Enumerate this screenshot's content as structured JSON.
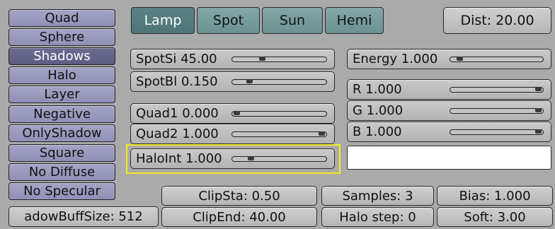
{
  "toggles": [
    {
      "id": "quad",
      "label": "Quad",
      "active": false
    },
    {
      "id": "sphere",
      "label": "Sphere",
      "active": false
    },
    {
      "id": "shadows",
      "label": "Shadows",
      "active": true
    },
    {
      "id": "halo",
      "label": "Halo",
      "active": false
    },
    {
      "id": "layer",
      "label": "Layer",
      "active": false
    },
    {
      "id": "negative",
      "label": "Negative",
      "active": false
    },
    {
      "id": "onlyshadow",
      "label": "OnlyShadow",
      "active": false
    },
    {
      "id": "square",
      "label": "Square",
      "active": false
    },
    {
      "id": "no-diffuse",
      "label": "No Diffuse",
      "active": false
    },
    {
      "id": "no-specular",
      "label": "No Specular",
      "active": false
    }
  ],
  "shadow_buffer_size": "adowBuffSize: 512",
  "lamp_types": [
    {
      "label": "Lamp",
      "active": true
    },
    {
      "label": "Spot",
      "active": false
    },
    {
      "label": "Sun",
      "active": false
    },
    {
      "label": "Hemi",
      "active": false
    }
  ],
  "dist": "Dist: 20.00",
  "sliders": {
    "spotsi": {
      "label": "SpotSi 45.00",
      "value": 0.3
    },
    "spotbl": {
      "label": "SpotBl 0.150",
      "value": 0.15
    },
    "quad1": {
      "label": "Quad1 0.000",
      "value": 0.0
    },
    "quad2": {
      "label": "Quad2 1.000",
      "value": 1.0
    },
    "haloint": {
      "label": "HaloInt 1.000",
      "value": 0.17
    },
    "energy": {
      "label": "Energy 1.000",
      "value": 0.06
    },
    "r": {
      "label": "R 1.000",
      "value": 1.0
    },
    "g": {
      "label": "G 1.000",
      "value": 1.0
    },
    "b": {
      "label": "B 1.000",
      "value": 1.0
    }
  },
  "color_swatch": "#ffffff",
  "highlight_color": "#f0ee1e",
  "clip_sta": "ClipSta: 0.50",
  "clip_end": "ClipEnd: 40.00",
  "samples": "Samples: 3",
  "halo_step": "Halo step: 0",
  "bias": "Bias: 1.000",
  "soft": "Soft: 3.00"
}
